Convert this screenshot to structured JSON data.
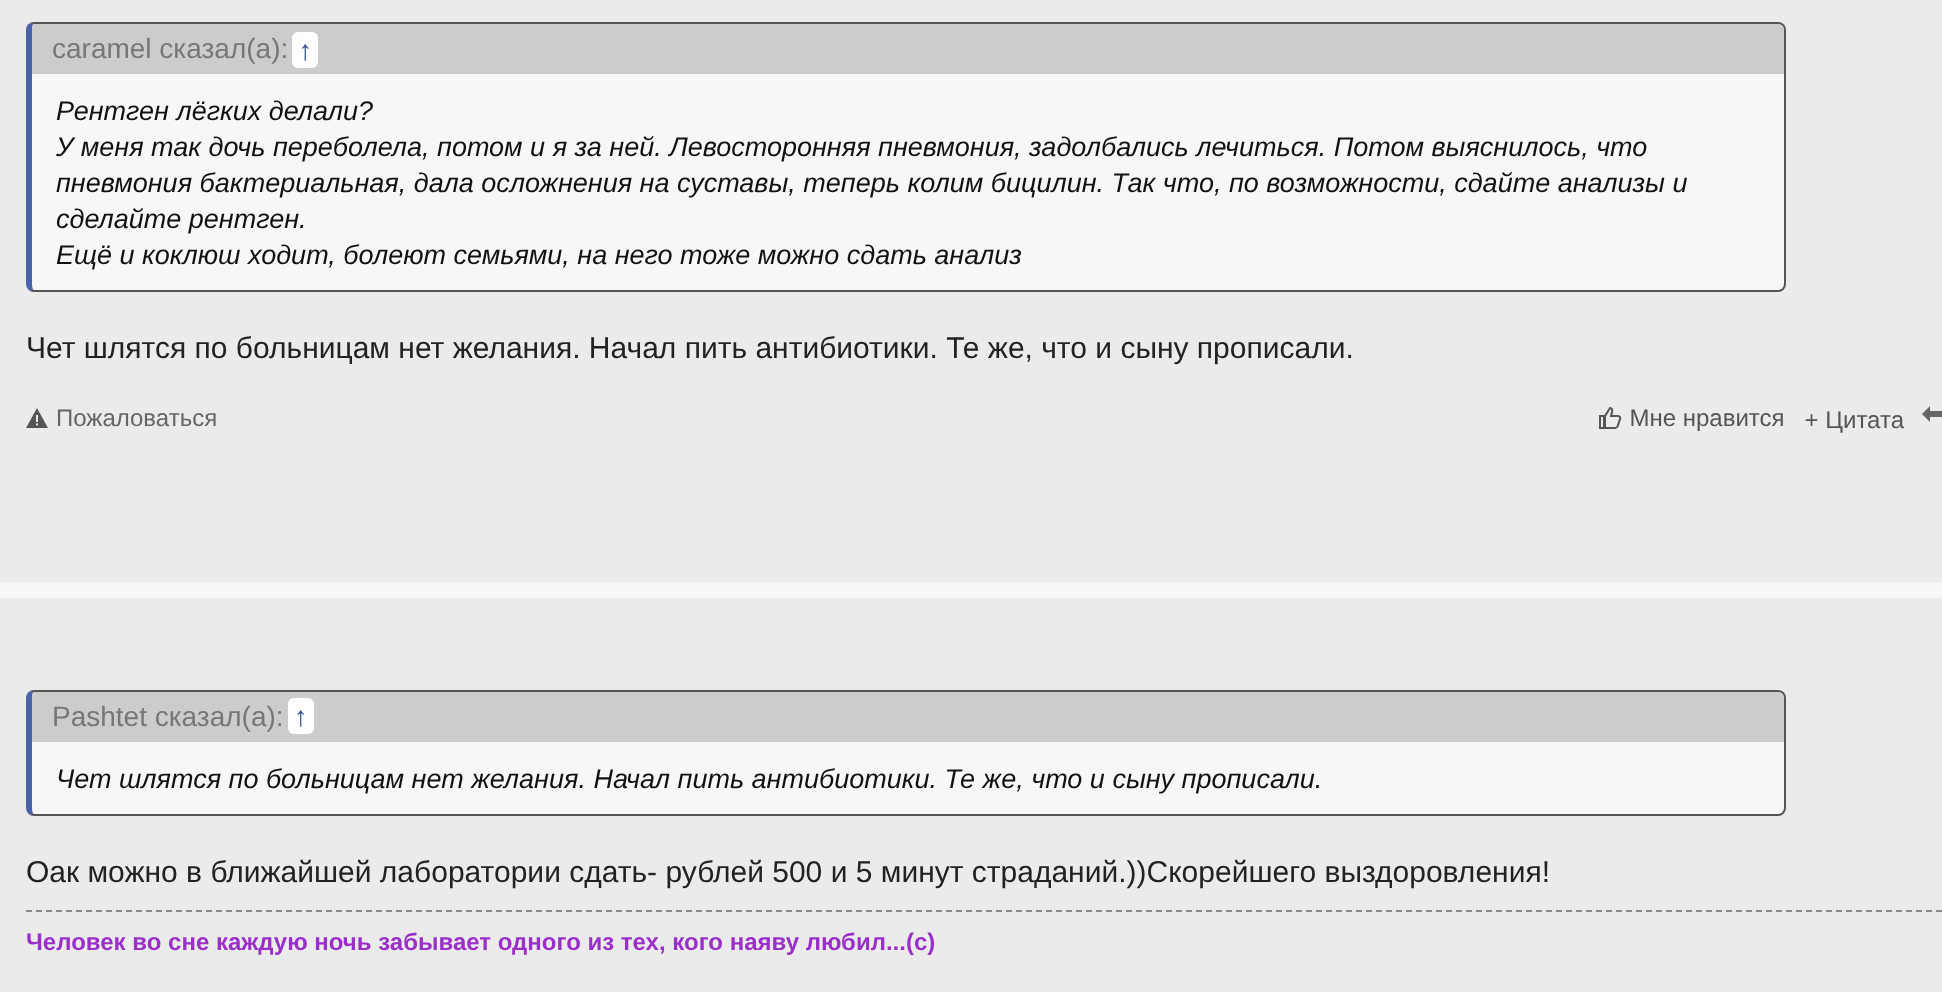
{
  "posts": [
    {
      "quote": {
        "author": "caramel сказал(а):",
        "jump": "↑",
        "lines": [
          "Рентген лёгких делали?",
          "У меня так дочь переболела, потом и я за ней. Левосторонняя пневмония, задолбались лечиться. Потом выяснилось, что пневмония бактериальная, дала осложнения на суставы, теперь колим бицилин. Так что, по возможности, сдайте анализы и сделайте рентген.",
          "Ещё и коклюш ходит, болеют семьями, на него тоже можно сдать анализ"
        ]
      },
      "text": "Чет шлятся по больницам нет желания. Начал пить антибиотики. Те же, что и сыну прописали.",
      "actions": {
        "report": "Пожаловаться",
        "like": "Мне нравится",
        "quote": "+ Цитата"
      }
    },
    {
      "quote": {
        "author": "Pashtet сказал(а):",
        "jump": "↑",
        "lines": [
          "Чет шлятся по больницам нет желания. Начал пить антибиотики. Те же, что и сыну прописали."
        ]
      },
      "text": "Оак можно в ближайшей лаборатории сдать- рублей 500 и 5 минут страданий.))Скорейшего выздоровления!",
      "signature": "Человек во сне каждую ночь забывает одного из тех, кого наяву любил...(c)"
    }
  ]
}
